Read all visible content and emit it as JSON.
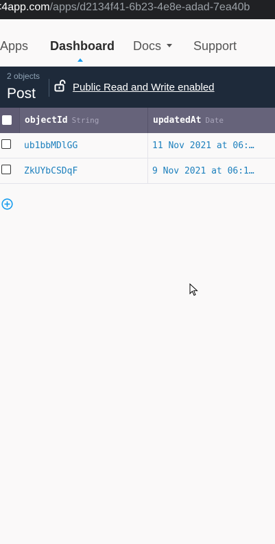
{
  "browser": {
    "url_host": "<4app.com",
    "url_path": "/apps/d2134f41-6b23-4e8e-adad-7ea40b"
  },
  "nav": {
    "items": [
      {
        "label": "Apps"
      },
      {
        "label": "Dashboard"
      },
      {
        "label": "Docs"
      },
      {
        "label": "Support"
      }
    ],
    "active": "Dashboard"
  },
  "class_header": {
    "count": "2 objects",
    "name": "Post",
    "permissions": "Public Read and Write enabled"
  },
  "table": {
    "columns": [
      {
        "name": "objectId",
        "type": "String"
      },
      {
        "name": "updatedAt",
        "type": "Date"
      }
    ],
    "rows": [
      {
        "objectId": "ub1bbMDlGG",
        "updatedAt": "11 Nov 2021 at 06:…"
      },
      {
        "objectId": "ZkUYbCSDqF",
        "updatedAt": "9 Nov 2021 at 06:1…"
      }
    ]
  },
  "colors": {
    "accent": "#169cee",
    "header_bg": "#66637a",
    "classbar_bg": "#1e2a3a"
  }
}
